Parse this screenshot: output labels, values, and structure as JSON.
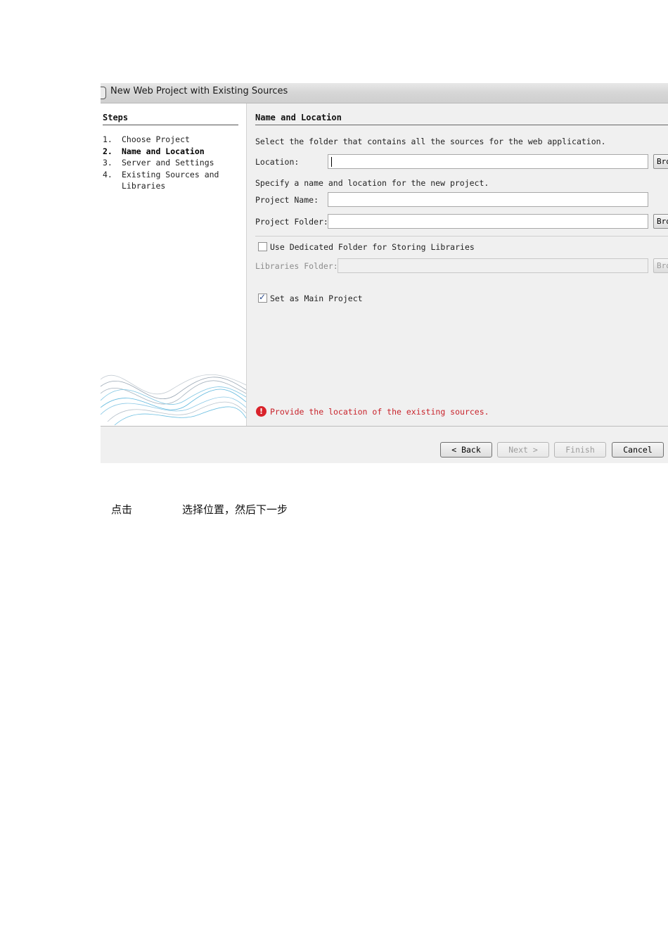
{
  "dialog": {
    "title": "New Web Project with Existing Sources",
    "steps_title": "Steps",
    "steps": [
      {
        "num": "1.",
        "label": "Choose Project",
        "current": false
      },
      {
        "num": "2.",
        "label": "Name and Location",
        "current": true
      },
      {
        "num": "3.",
        "label": "Server and Settings",
        "current": false
      },
      {
        "num": "4.",
        "label": "Existing Sources and",
        "label2": "Libraries",
        "current": false
      }
    ],
    "section_title": "Name and Location",
    "intro": "Select the folder that contains all the sources for the web application.",
    "location_label": "Location:",
    "location_value": "",
    "specify_text": "Specify a name and location for the new project.",
    "project_name_label": "Project Name:",
    "project_name_value": "",
    "project_folder_label": "Project Folder:",
    "project_folder_value": "",
    "browse_label": "Browse...",
    "dedicated_folder_label": "Use Dedicated Folder for Storing Libraries",
    "dedicated_folder_checked": false,
    "libraries_folder_label": "Libraries Folder:",
    "libraries_folder_value": "",
    "main_project_label": "Set as Main Project",
    "main_project_checked": true,
    "error_message": "Provide the location of the existing sources.",
    "buttons": {
      "back": "< Back",
      "next": "Next >",
      "finish": "Finish",
      "cancel": "Cancel"
    }
  },
  "caption": {
    "part1": "点击",
    "part2": "选择位置，然后下一步"
  }
}
